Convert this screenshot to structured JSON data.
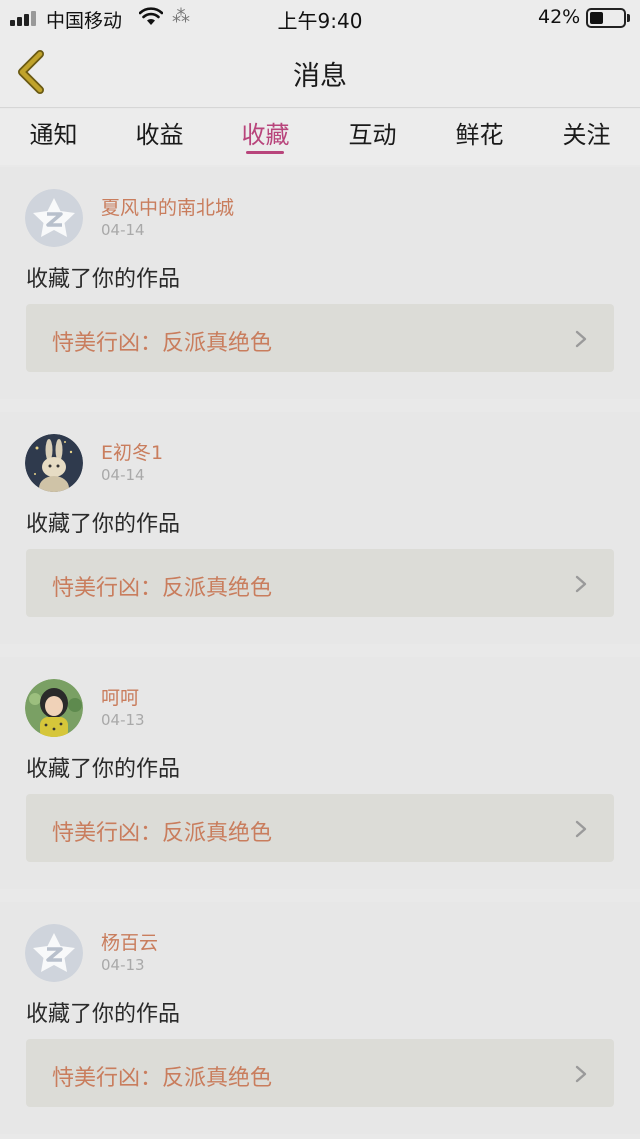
{
  "status_bar": {
    "carrier": "中国移动",
    "loading": "⁂",
    "time": "上午9:40",
    "battery": "42%",
    "battery_level": 0.42
  },
  "header": {
    "title": "消息"
  },
  "tabs": [
    {
      "label": "通知",
      "active": false
    },
    {
      "label": "收益",
      "active": false
    },
    {
      "label": "收藏",
      "active": true
    },
    {
      "label": "互动",
      "active": false
    },
    {
      "label": "鲜花",
      "active": false
    },
    {
      "label": "关注",
      "active": false
    }
  ],
  "messages": [
    {
      "username": "夏风中的南北城",
      "date": "04-14",
      "action": "收藏了你的作品",
      "work_title": "恃美行凶：反派真绝色",
      "avatar": "default-avatar-icon"
    },
    {
      "username": "E初冬1",
      "date": "04-14",
      "action": "收藏了你的作品",
      "work_title": "恃美行凶：反派真绝色",
      "avatar": "rabbit-photo-avatar"
    },
    {
      "username": "呵呵",
      "date": "04-13",
      "action": "收藏了你的作品",
      "work_title": "恃美行凶：反派真绝色",
      "avatar": "girl-photo-avatar"
    },
    {
      "username": "杨百云",
      "date": "04-13",
      "action": "收藏了你的作品",
      "work_title": "恃美行凶：反派真绝色",
      "avatar": "default-avatar-icon"
    }
  ],
  "colors": {
    "accent": "#b8447b",
    "link": "#c97d5d",
    "back_arrow": "#b59a26"
  }
}
